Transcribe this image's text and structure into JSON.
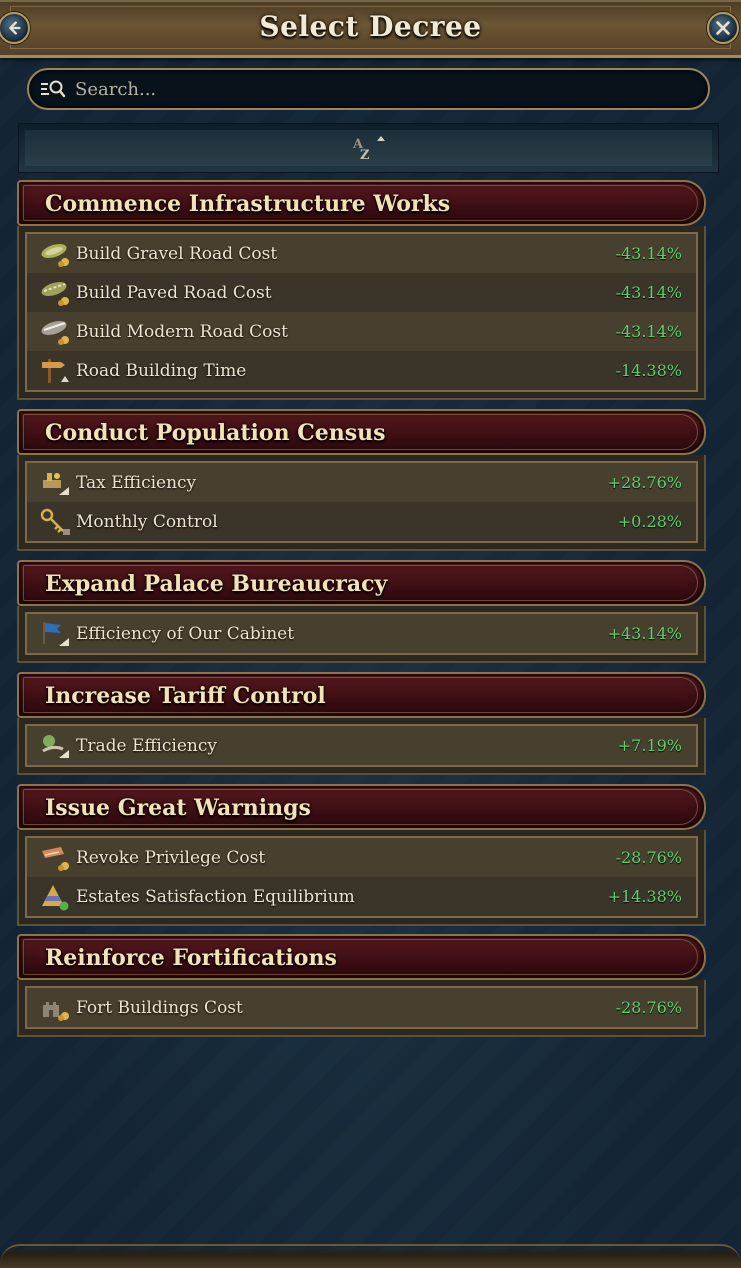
{
  "window": {
    "title": "Select Decree"
  },
  "search": {
    "placeholder": "Search..."
  },
  "sort": {
    "label": "AZ"
  },
  "groups": [
    {
      "title": "Commence Infrastructure Works",
      "rows": [
        {
          "icon": "gravel-road-icon",
          "label": "Build Gravel Road Cost",
          "value": "-43.14%"
        },
        {
          "icon": "paved-road-icon",
          "label": "Build Paved Road Cost",
          "value": "-43.14%"
        },
        {
          "icon": "modern-road-icon",
          "label": "Build Modern Road Cost",
          "value": "-43.14%"
        },
        {
          "icon": "road-sign-icon",
          "label": "Road Building Time",
          "value": "-14.38%"
        }
      ]
    },
    {
      "title": "Conduct Population Census",
      "rows": [
        {
          "icon": "tax-efficiency-icon",
          "label": "Tax Efficiency",
          "value": "+28.76%"
        },
        {
          "icon": "key-control-icon",
          "label": "Monthly Control",
          "value": "+0.28%"
        }
      ]
    },
    {
      "title": "Expand Palace Bureaucracy",
      "rows": [
        {
          "icon": "cabinet-flag-icon",
          "label": "Efficiency of Our Cabinet",
          "value": "+43.14%"
        }
      ]
    },
    {
      "title": "Increase Tariff Control",
      "rows": [
        {
          "icon": "trade-icon",
          "label": "Trade Efficiency",
          "value": "+7.19%"
        }
      ]
    },
    {
      "title": "Issue Great Warnings",
      "rows": [
        {
          "icon": "privilege-scroll-icon",
          "label": "Revoke Privilege Cost",
          "value": "-28.76%"
        },
        {
          "icon": "estates-pyramid-icon",
          "label": "Estates Satisfaction Equilibrium",
          "value": "+14.38%"
        }
      ]
    },
    {
      "title": "Reinforce Fortifications",
      "rows": [
        {
          "icon": "fort-icon",
          "label": "Fort Buildings Cost",
          "value": "-28.76%"
        }
      ]
    }
  ],
  "colors": {
    "positive_value": "#5ed16f",
    "group_header": "#4a1419",
    "frame_gold": "#a88a52",
    "background": "#132535"
  }
}
